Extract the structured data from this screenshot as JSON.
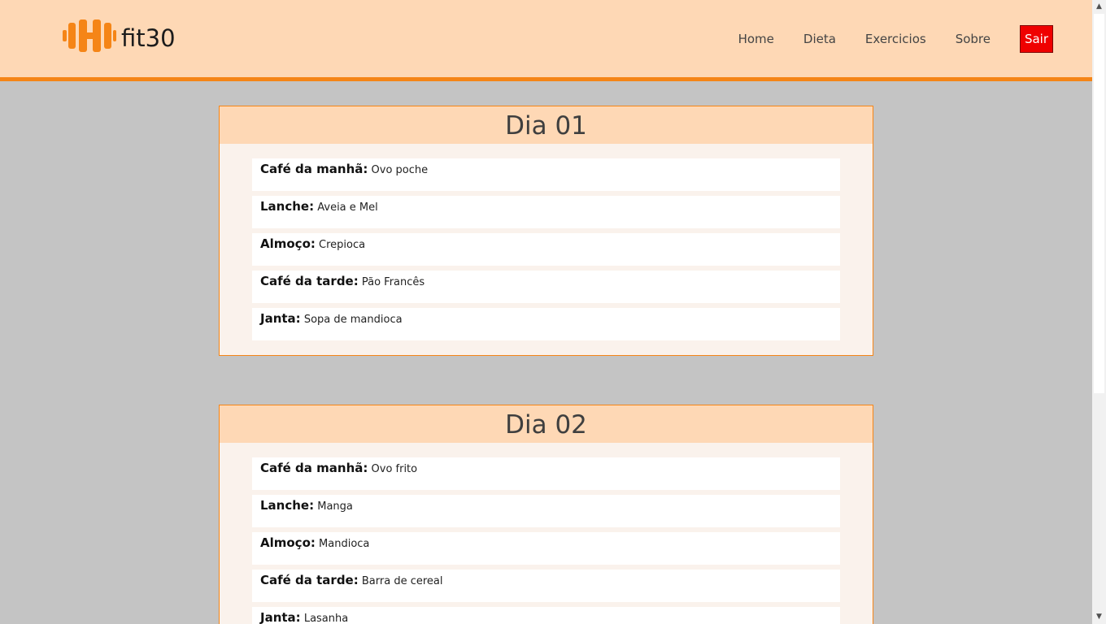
{
  "header": {
    "logo_text": "fit30",
    "logo_icon": "dumbbell-icon",
    "nav": [
      {
        "label": "Home"
      },
      {
        "label": "Dieta"
      },
      {
        "label": "Exercicios"
      },
      {
        "label": "Sobre"
      }
    ],
    "logout_label": "Sair"
  },
  "colors": {
    "header_bg": "#fed8b5",
    "accent": "#f58517",
    "logout_bg": "#ef0000",
    "page_bg": "#c4c4c4",
    "card_bg": "#faf2ec"
  },
  "days": [
    {
      "title": "Dia 01",
      "meals": [
        {
          "label": "Café da manhã:",
          "value": "Ovo poche"
        },
        {
          "label": "Lanche:",
          "value": "Aveia e Mel"
        },
        {
          "label": "Almoço:",
          "value": "Crepioca"
        },
        {
          "label": "Café da tarde:",
          "value": "Pão Francês"
        },
        {
          "label": "Janta:",
          "value": "Sopa de mandioca"
        }
      ]
    },
    {
      "title": "Dia 02",
      "meals": [
        {
          "label": "Café da manhã:",
          "value": "Ovo frito"
        },
        {
          "label": "Lanche:",
          "value": "Manga"
        },
        {
          "label": "Almoço:",
          "value": "Mandioca"
        },
        {
          "label": "Café da tarde:",
          "value": "Barra de cereal"
        },
        {
          "label": "Janta:",
          "value": "Lasanha"
        }
      ]
    }
  ]
}
